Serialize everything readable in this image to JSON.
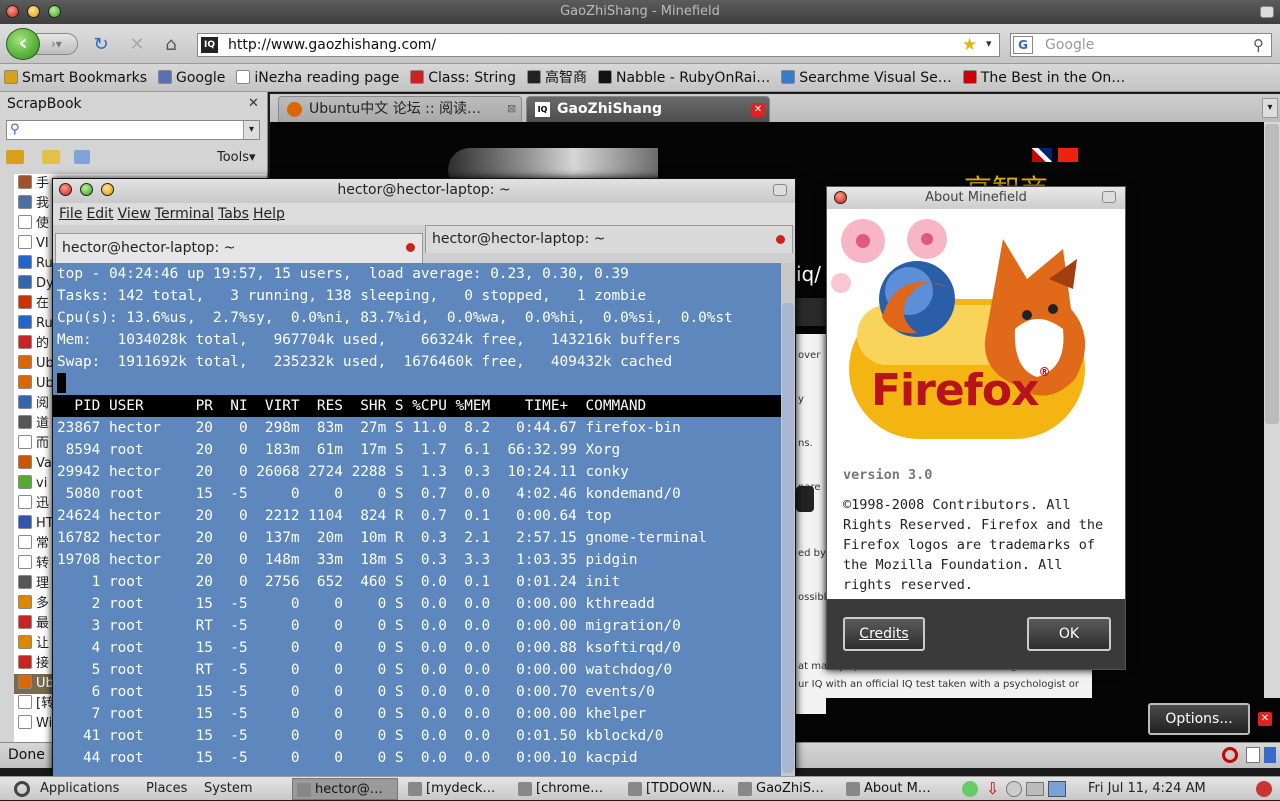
{
  "firefox": {
    "window_title": "GaoZhiShang - Minefield",
    "url": "http://www.gaozhishang.com/",
    "url_favicon": "IQ",
    "search_placeholder": "Google",
    "search_engine_icon": "G",
    "bookmarks": [
      {
        "label": "Smart Bookmarks",
        "icon": "folder-icon",
        "color": "#d9a01a"
      },
      {
        "label": "Google",
        "icon": "google-icon",
        "color": "#5b6fb3"
      },
      {
        "label": "iNezha reading page",
        "icon": "page-icon",
        "color": "#ffffff"
      },
      {
        "label": "Class: String",
        "icon": "ruby-icon",
        "color": "#c22"
      },
      {
        "label": "高智商",
        "icon": "iq-icon",
        "color": "#222"
      },
      {
        "label": "Nabble - RubyOnRai…",
        "icon": "nabble-icon",
        "color": "#111"
      },
      {
        "label": "Searchme Visual Se…",
        "icon": "searchme-icon",
        "color": "#3a7acb"
      },
      {
        "label": "The Best in the On…",
        "icon": "t-icon",
        "color": "#c00"
      }
    ],
    "tabs": [
      {
        "label": "Ubuntu中文 论坛 :: 阅读…",
        "active": false
      },
      {
        "label": "GaoZhiShang",
        "active": true
      }
    ],
    "status": "Done",
    "page": {
      "heading_cn": "高智商",
      "url_fragment": "iq/",
      "snippets": [
        "over y",
        "ns.",
        "pare",
        "ed by",
        "ossibl"
      ],
      "footer_lines": [
        "at mainly operates online, before becoming a member of",
        "ur IQ with an official IQ test taken with a psychologist or"
      ]
    },
    "options_button": "Options..."
  },
  "sidebar": {
    "title": "ScrapBook",
    "tools_label": "Tools",
    "items": [
      {
        "label": "手",
        "color": "#a0522d"
      },
      {
        "label": "我",
        "color": "#4a6fa5"
      },
      {
        "label": "使",
        "color": "#ffffff"
      },
      {
        "label": "VI",
        "color": "#ffffff"
      },
      {
        "label": "Ru",
        "color": "#2266cc"
      },
      {
        "label": "Dy",
        "color": "#3366aa"
      },
      {
        "label": "在",
        "color": "#cc3300"
      },
      {
        "label": "Ru",
        "color": "#2266cc"
      },
      {
        "label": "的",
        "color": "#cc2222"
      },
      {
        "label": "Ub",
        "color": "#dd6600"
      },
      {
        "label": "Ub",
        "color": "#dd6600"
      },
      {
        "label": "阅",
        "color": "#3366aa"
      },
      {
        "label": "道",
        "color": "#555555"
      },
      {
        "label": "而",
        "color": "#ffffff"
      },
      {
        "label": "Va",
        "color": "#cc5500"
      },
      {
        "label": "vi",
        "color": "#55aa33"
      },
      {
        "label": "迅",
        "color": "#ffffff"
      },
      {
        "label": "HT",
        "color": "#3355aa"
      },
      {
        "label": "常",
        "color": "#ffffff"
      },
      {
        "label": "转",
        "color": "#ffffff"
      },
      {
        "label": "理",
        "color": "#555555"
      },
      {
        "label": "多",
        "color": "#dd8800"
      },
      {
        "label": "最",
        "color": "#cc2222"
      },
      {
        "label": "让",
        "color": "#dd8800"
      },
      {
        "label": "接",
        "color": "#cc2222"
      },
      {
        "label": "Ub",
        "color": "#dd6600"
      },
      {
        "label": "[转",
        "color": "#ffffff"
      },
      {
        "label": "Wi",
        "color": "#ffffff"
      }
    ]
  },
  "terminal": {
    "title": "hector@hector-laptop: ~",
    "menu": [
      "File",
      "Edit",
      "View",
      "Terminal",
      "Tabs",
      "Help"
    ],
    "tabs": [
      "hector@hector-laptop: ~",
      "hector@hector-laptop: ~"
    ],
    "summary": [
      "top - 04:24:46 up 19:57, 15 users,  load average: 0.23, 0.30, 0.39",
      "Tasks: 142 total,   3 running, 138 sleeping,   0 stopped,   1 zombie",
      "Cpu(s): 13.6%us,  2.7%sy,  0.0%ni, 83.7%id,  0.0%wa,  0.0%hi,  0.0%si,  0.0%st",
      "Mem:   1034028k total,   967704k used,    66324k free,   143216k buffers",
      "Swap:  1911692k total,   235232k used,  1676460k free,   409432k cached",
      ""
    ],
    "header": "  PID USER      PR  NI  VIRT  RES  SHR S %CPU %MEM    TIME+  COMMAND                  ",
    "processes": [
      "23867 hector    20   0  298m  83m  27m S 11.0  8.2   0:44.67 firefox-bin",
      " 8594 root      20   0  183m  61m  17m S  1.7  6.1  66:32.99 Xorg",
      "29942 hector    20   0 26068 2724 2288 S  1.3  0.3  10:24.11 conky",
      " 5080 root      15  -5     0    0    0 S  0.7  0.0   4:02.46 kondemand/0",
      "24624 hector    20   0  2212 1104  824 R  0.7  0.1   0:00.64 top",
      "16782 hector    20   0  137m  20m  10m R  0.3  2.1   2:57.15 gnome-terminal",
      "19708 hector    20   0  148m  33m  18m S  0.3  3.3   1:03.35 pidgin",
      "    1 root      20   0  2756  652  460 S  0.0  0.1   0:01.24 init",
      "    2 root      15  -5     0    0    0 S  0.0  0.0   0:00.00 kthreadd",
      "    3 root      RT  -5     0    0    0 S  0.0  0.0   0:00.00 migration/0",
      "    4 root      15  -5     0    0    0 S  0.0  0.0   0:00.88 ksoftirqd/0",
      "    5 root      RT  -5     0    0    0 S  0.0  0.0   0:00.00 watchdog/0",
      "    6 root      15  -5     0    0    0 S  0.0  0.0   0:00.70 events/0",
      "    7 root      15  -5     0    0    0 S  0.0  0.0   0:00.00 khelper",
      "   41 root      15  -5     0    0    0 S  0.0  0.0   0:01.50 kblockd/0",
      "   44 root      15  -5     0    0    0 S  0.0  0.0   0:00.10 kacpid"
    ]
  },
  "about": {
    "title": "About Minefield",
    "brand": "Firefox",
    "registered": "®",
    "version": "version 3.0",
    "copyright": "©1998-2008 Contributors. All Rights Reserved. Firefox and the Firefox logos are trademarks of the Mozilla Foundation. All rights reserved.",
    "credits_button": "Credits",
    "ok_button": "OK"
  },
  "panel": {
    "menus": [
      "Applications",
      "Places",
      "System"
    ],
    "tasks": [
      {
        "label": "hector@…",
        "active": true
      },
      {
        "label": "[mydeck…",
        "active": false
      },
      {
        "label": "[chrome…",
        "active": false
      },
      {
        "label": "[TDDOWN…",
        "active": false
      },
      {
        "label": "GaoZhiS…",
        "active": false
      },
      {
        "label": "About M…",
        "active": false
      }
    ],
    "clock": "Fri Jul 11,  4:24 AM"
  },
  "colors": {
    "terminal_bg": "#5e87bd",
    "page_bg": "#050505",
    "accent_green": "#3d9a1e"
  }
}
